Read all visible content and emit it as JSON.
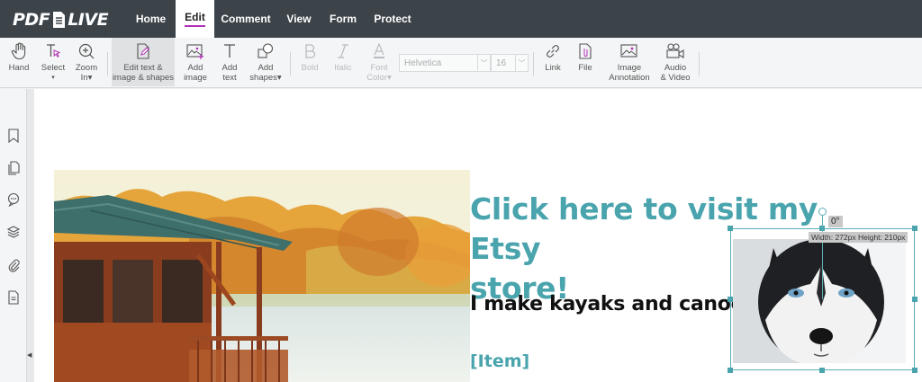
{
  "app": {
    "logo_left": "PDF",
    "logo_right": "LIVE"
  },
  "nav": {
    "tabs": [
      {
        "label": "Home"
      },
      {
        "label": "Edit"
      },
      {
        "label": "Comment"
      },
      {
        "label": "View"
      },
      {
        "label": "Form"
      },
      {
        "label": "Protect"
      }
    ],
    "active_tab": "Edit"
  },
  "toolbar": {
    "hand": {
      "line1": "Hand",
      "line2": ""
    },
    "select": {
      "line1": "Select",
      "line2": "▾"
    },
    "zoom": {
      "line1": "Zoom",
      "line2": "In▾"
    },
    "edit_text": {
      "line1": "Edit text &",
      "line2": "image & shapes"
    },
    "add_image": {
      "line1": "Add",
      "line2": "image"
    },
    "add_text": {
      "line1": "Add",
      "line2": "text"
    },
    "add_shapes": {
      "line1": "Add",
      "line2": "shapes▾"
    },
    "bold": {
      "line1": "Bold"
    },
    "italic": {
      "line1": "Italic"
    },
    "font_color": {
      "line1": "Font",
      "line2": "Color▾"
    },
    "font_family": "Helvetica",
    "font_size": "16",
    "link": {
      "line1": "Link"
    },
    "file": {
      "line1": "File"
    },
    "image_annotation": {
      "line1": "Image",
      "line2": "Annotation"
    },
    "audio_video": {
      "line1": "Audio",
      "line2": "& Video"
    }
  },
  "document": {
    "headline_line1": "Click here to visit my Etsy",
    "headline_line2": "store!",
    "subheadline": "I make kayaks and canoes.",
    "item": "[Item]"
  },
  "selection": {
    "angle": "0°",
    "dimensions": "Width: 272px  Height: 210px"
  },
  "colors": {
    "nav_bg": "#3c4349",
    "accent_tab": "#b12fb6",
    "teal": "#4aa4ad"
  }
}
